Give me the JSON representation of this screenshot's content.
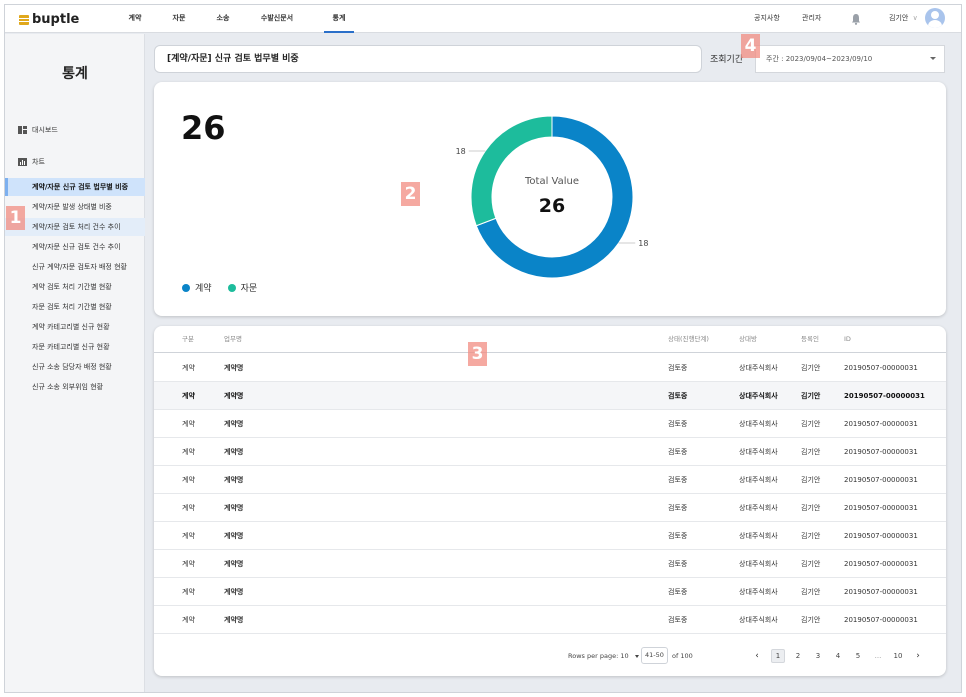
{
  "app": {
    "logo": "buptle",
    "nav": [
      "계약",
      "자문",
      "소송",
      "수발신문서",
      "통계"
    ],
    "active_nav": 4,
    "notice": "공지사항",
    "admin": "관리자",
    "user_name": "김기안",
    "user_caret": "∨"
  },
  "sidebar": {
    "title": "통계",
    "sections": [
      "대시보드",
      "차트"
    ],
    "items": [
      "계약/자문 신규 검토 법무별 비중",
      "계약/자문 발생 상태별 비중",
      "계약/자문 검토 처리 건수 추이",
      "계약/자문 신규 검토 건수 추이",
      "신규 계약/자문 검토자 배정 현황",
      "계약 검토 처리 기간별 현황",
      "자문 검토 처리 기간별 현황",
      "계약 카테고리별 신규 현황",
      "자문 카테고리별 신규 현황",
      "신규 소송 담당자 배정 현황",
      "신규 소송 외부위임 현황"
    ]
  },
  "header": {
    "title": "[계약/자문] 신규 검토 법무별 비중",
    "period_label": "조회기간",
    "period_value": "주간 : 2023/09/04~2023/09/10"
  },
  "summary": {
    "total": "26",
    "center_label": "Total Value",
    "center_value": "26"
  },
  "colors": {
    "contract": "#0a84c8",
    "advice": "#1dbc9c",
    "accent": "#2a6fc9"
  },
  "chart_data": {
    "type": "pie",
    "variant": "donut",
    "categories": [
      "계약",
      "자문"
    ],
    "values": [
      18,
      8
    ],
    "value_labels": [
      "18",
      "18"
    ],
    "center_label": "Total Value",
    "center_value": 26,
    "legend": [
      "계약",
      "자문"
    ],
    "legend_position": "bottom-left"
  },
  "table": {
    "headers": [
      "구분",
      "업무명",
      "상태(진행단계)",
      "상대방",
      "등록인",
      "ID"
    ],
    "rows": [
      [
        "계약",
        "계약명",
        "검토중",
        "상대주식회사",
        "김기안",
        "20190507-00000031"
      ],
      [
        "계약",
        "계약명",
        "검토중",
        "상대주식회사",
        "김기안",
        "20190507-00000031"
      ],
      [
        "계약",
        "계약명",
        "검토중",
        "상대주식회사",
        "김기안",
        "20190507-00000031"
      ],
      [
        "계약",
        "계약명",
        "검토중",
        "상대주식회사",
        "김기안",
        "20190507-00000031"
      ],
      [
        "계약",
        "계약명",
        "검토중",
        "상대주식회사",
        "김기안",
        "20190507-00000031"
      ],
      [
        "계약",
        "계약명",
        "검토중",
        "상대주식회사",
        "김기안",
        "20190507-00000031"
      ],
      [
        "계약",
        "계약명",
        "검토중",
        "상대주식회사",
        "김기안",
        "20190507-00000031"
      ],
      [
        "계약",
        "계약명",
        "검토중",
        "상대주식회사",
        "김기안",
        "20190507-00000031"
      ],
      [
        "계약",
        "계약명",
        "검토중",
        "상대주식회사",
        "김기안",
        "20190507-00000031"
      ],
      [
        "계약",
        "계약명",
        "검토중",
        "상대주식회사",
        "김기안",
        "20190507-00000031"
      ]
    ],
    "selected_row": 1
  },
  "pagination": {
    "rows_per_page_label": "Rows per page: 10",
    "range": "41-50",
    "of_total": "of 100",
    "pages": [
      "1",
      "2",
      "3",
      "4",
      "5",
      "...",
      "10"
    ],
    "current_page": "1",
    "prev": "‹",
    "next": "›"
  },
  "markers": [
    "1",
    "2",
    "3",
    "4"
  ]
}
